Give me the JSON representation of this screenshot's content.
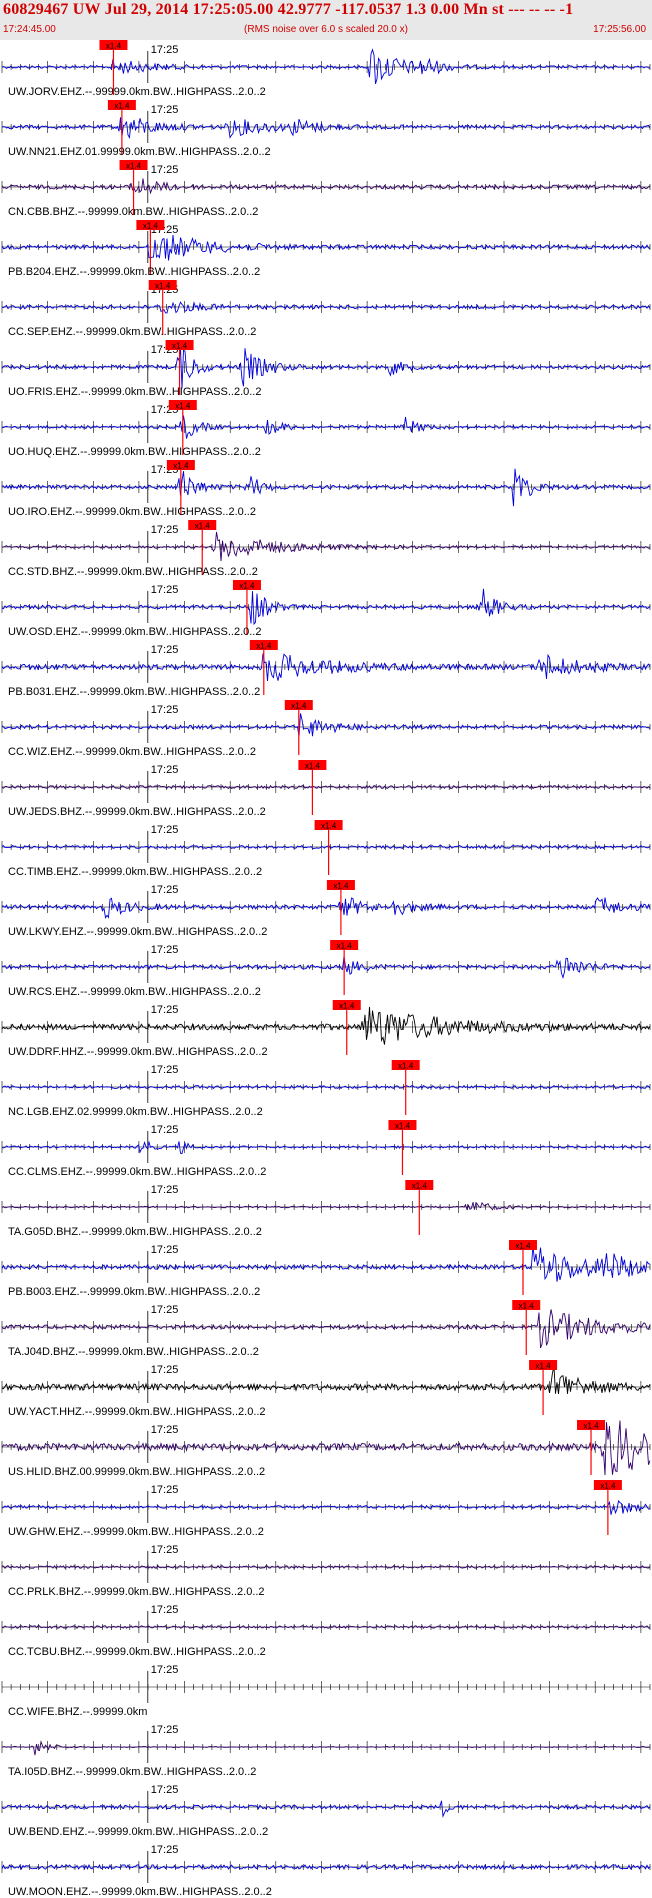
{
  "header": {
    "title": "60829467 UW Jul 29, 2014 17:25:05.00   42.9777 -117.0537  1.3 0.00 Mn st --- -- --  -1",
    "start_time": "17:24:45.00",
    "rms_note": "(RMS noise over 6.0 s scaled 20.0 x)",
    "end_time": "17:25:56.00"
  },
  "chart_data": {
    "type": "line",
    "time_start": "17:24:45.00",
    "time_end": "17:25:56.00",
    "minute_label": "17:25",
    "pick_label": "x1.4",
    "traces": [
      {
        "label": "UW.JORV.EHZ.--.99999.0km.BW..HIGHPASS..2.0..2",
        "color": "#0000dd",
        "pick": 17.2,
        "noise": 0.9,
        "bursts": [
          [
            17.2,
            5,
            1.6
          ],
          [
            57,
            4,
            4.5
          ],
          [
            65,
            2,
            2
          ]
        ]
      },
      {
        "label": "UW.NN21.EHZ.01.99999.0km.BW..HIGHPASS..2.0..2",
        "color": "#0000dd",
        "pick": 18.5,
        "noise": 1.1,
        "bursts": [
          [
            18.5,
            4,
            3
          ],
          [
            35,
            6,
            1.8
          ],
          [
            45,
            3,
            1.5
          ]
        ]
      },
      {
        "label": "CN.CBB.BHZ.--.99999.0km.BW..HIGHPASS..2.0..2",
        "color": "#33006a",
        "pick": 20.3,
        "noise": 1.2,
        "bursts": [
          [
            20.3,
            3,
            2.5
          ]
        ]
      },
      {
        "label": "PB.B204.EHZ.--.99999.0km.BW..HIGHPASS..2.0..2",
        "color": "#0000dd",
        "pick": 22.9,
        "noise": 1.2,
        "bursts": [
          [
            22.9,
            7,
            3.5
          ]
        ]
      },
      {
        "label": "CC.SEP.EHZ.--.99999.0km.BW..HIGHPASS..2.0..2",
        "color": "#0000dd",
        "pick": 24.8,
        "noise": 1.1,
        "bursts": [
          [
            24.8,
            4,
            1.7
          ]
        ]
      },
      {
        "label": "UO.FRIS.EHZ.--.99999.0km.BW..HIGHPASS..2.0..2",
        "color": "#0000dd",
        "pick": 27.4,
        "noise": 1.1,
        "bursts": [
          [
            27.4,
            2,
            5
          ],
          [
            37,
            3,
            4
          ],
          [
            60,
            2,
            1.5
          ]
        ]
      },
      {
        "label": "UO.HUQ.EHZ.--.99999.0km.BW..HIGHPASS..2.0..2",
        "color": "#0000dd",
        "pick": 27.9,
        "noise": 0.9,
        "bursts": [
          [
            27.9,
            2,
            3
          ],
          [
            41,
            2,
            1.8
          ],
          [
            62,
            2,
            2
          ]
        ]
      },
      {
        "label": "UO.IRO.EHZ.--.99999.0km.BW..HIGHPASS..2.0..2",
        "color": "#0000dd",
        "pick": 27.6,
        "noise": 1.1,
        "bursts": [
          [
            27.6,
            2,
            4
          ],
          [
            38,
            2,
            2.5
          ],
          [
            79,
            2,
            5
          ]
        ]
      },
      {
        "label": "CC.STD.BHZ.--.99999.0km.BW..HIGHPASS..2.0..2",
        "color": "#33006a",
        "pick": 30.9,
        "noise": 0.8,
        "bursts": [
          [
            33,
            8,
            3
          ]
        ]
      },
      {
        "label": "UW.OSD.EHZ.--.99999.0km.BW..HIGHPASS..2.0..2",
        "color": "#0000dd",
        "pick": 37.8,
        "noise": 1.1,
        "bursts": [
          [
            38.5,
            2,
            4.5
          ],
          [
            74,
            2,
            4
          ]
        ]
      },
      {
        "label": "PB.B031.EHZ.--.99999.0km.BW..HIGHPASS..2.0..2",
        "color": "#0000dd",
        "pick": 40.4,
        "noise": 1.6,
        "bursts": [
          [
            40.4,
            8,
            3.2
          ],
          [
            83,
            5,
            2.8
          ]
        ]
      },
      {
        "label": "CC.WIZ.EHZ.--.99999.0km.BW..HIGHPASS..2.0..2",
        "color": "#0000dd",
        "pick": 45.8,
        "noise": 1.1,
        "bursts": [
          [
            46,
            4,
            2.5
          ]
        ]
      },
      {
        "label": "UW.JEDS.BHZ.--.99999.0km.BW..HIGHPASS..2.0..2",
        "color": "#33006a",
        "pick": 47.9,
        "noise": 0.9,
        "bursts": []
      },
      {
        "label": "CC.TIMB.EHZ.--.99999.0km.BW..HIGHPASS..2.0..2",
        "color": "#0000dd",
        "pick": 50.4,
        "noise": 0.9,
        "bursts": []
      },
      {
        "label": "UW.LKWY.EHZ.--.99999.0km.BW..HIGHPASS..2.0..2",
        "color": "#0000dd",
        "pick": 52.3,
        "noise": 1.2,
        "bursts": [
          [
            16,
            3,
            2.2
          ],
          [
            52.3,
            3,
            2.5
          ],
          [
            60,
            3,
            1.8
          ],
          [
            92,
            3,
            2.3
          ]
        ]
      },
      {
        "label": "UW.RCS.EHZ.--.99999.0km.BW..HIGHPASS..2.0..2",
        "color": "#0000dd",
        "pick": 52.8,
        "noise": 1.2,
        "bursts": [
          [
            52.8,
            2,
            2
          ],
          [
            86,
            3,
            3
          ]
        ]
      },
      {
        "label": "UW.DDRF.HHZ.--.99999.0km.BW..HIGHPASS..2.0..2",
        "color": "#000000",
        "pick": 53.2,
        "noise": 1.8,
        "bursts": [
          [
            56,
            10,
            4.5
          ]
        ]
      },
      {
        "label": "NC.LGB.EHZ.02.99999.0km.BW..HIGHPASS..2.0..2",
        "color": "#0000dd",
        "pick": 62.3,
        "noise": 0.9,
        "bursts": []
      },
      {
        "label": "CC.CLMS.EHZ.--.99999.0km.BW..HIGHPASS..2.0..2",
        "color": "#0000dd",
        "pick": 61.8,
        "noise": 0.7,
        "bursts": [
          [
            21.5,
            1,
            2.5
          ],
          [
            27.5,
            1,
            1.5
          ]
        ]
      },
      {
        "label": "TA.G05D.BHZ.--.99999.0km.BW..HIGHPASS..2.0..2",
        "color": "#33006a",
        "pick": 64.4,
        "noise": 0.5,
        "bursts": [
          [
            72,
            3,
            1.5
          ]
        ]
      },
      {
        "label": "PB.B003.EHZ.--.99999.0km.BW..HIGHPASS..2.0..2",
        "color": "#0000dd",
        "pick": 80.4,
        "noise": 1.3,
        "bursts": [
          [
            82,
            8,
            4.5
          ],
          [
            93,
            5,
            2
          ]
        ]
      },
      {
        "label": "TA.J04D.BHZ.--.99999.0km.BW..HIGHPASS..2.0..2",
        "color": "#33006a",
        "pick": 80.9,
        "noise": 1.2,
        "bursts": [
          [
            83,
            8,
            4
          ]
        ]
      },
      {
        "label": "UW.YACT.HHZ.--.99999.0km.BW..HIGHPASS..2.0..2",
        "color": "#000000",
        "pick": 83.5,
        "noise": 2,
        "bursts": [
          [
            85,
            4,
            4
          ]
        ]
      },
      {
        "label": "US.HLID.BHZ.00.99999.0km.BW..HIGHPASS..2.0..2",
        "color": "#33006a",
        "pick": 90.9,
        "noise": 2.2,
        "bursts": [
          [
            93,
            10,
            6
          ]
        ]
      },
      {
        "label": "UW.GHW.EHZ.--.99999.0km.BW..HIGHPASS..2.0..2",
        "color": "#0000dd",
        "pick": 93.5,
        "noise": 0.9,
        "bursts": [
          [
            94,
            3,
            2
          ]
        ]
      },
      {
        "label": "CC.PRLK.BHZ.--.99999.0km.BW..HIGHPASS..2.0..2",
        "color": "#33006a",
        "pick": null,
        "noise": 0.8,
        "bursts": []
      },
      {
        "label": "CC.TCBU.BHZ.--.99999.0km.BW..HIGHPASS..2.0..2",
        "color": "#33006a",
        "pick": null,
        "noise": 0.8,
        "bursts": []
      },
      {
        "label": "CC.WIFE.BHZ.--.99999.0km",
        "color": "#33006a",
        "pick": null,
        "noise": 0,
        "bursts": []
      },
      {
        "label": "TA.I05D.BHZ.--.99999.0km.BW..HIGHPASS..2.0..2",
        "color": "#33006a",
        "pick": null,
        "noise": 0.3,
        "bursts": [
          [
            5,
            2,
            1.8
          ]
        ]
      },
      {
        "label": "UW.BEND.EHZ.--.99999.0km.BW..HIGHPASS..2.0..2",
        "color": "#0000dd",
        "pick": null,
        "noise": 1.1,
        "bursts": [
          [
            68,
            1,
            1.6
          ]
        ]
      },
      {
        "label": "UW.MOON.EHZ.--.99999.0km.BW..HIGHPASS..2.0..2",
        "color": "#0000dd",
        "pick": null,
        "noise": 1.3,
        "bursts": []
      }
    ]
  }
}
